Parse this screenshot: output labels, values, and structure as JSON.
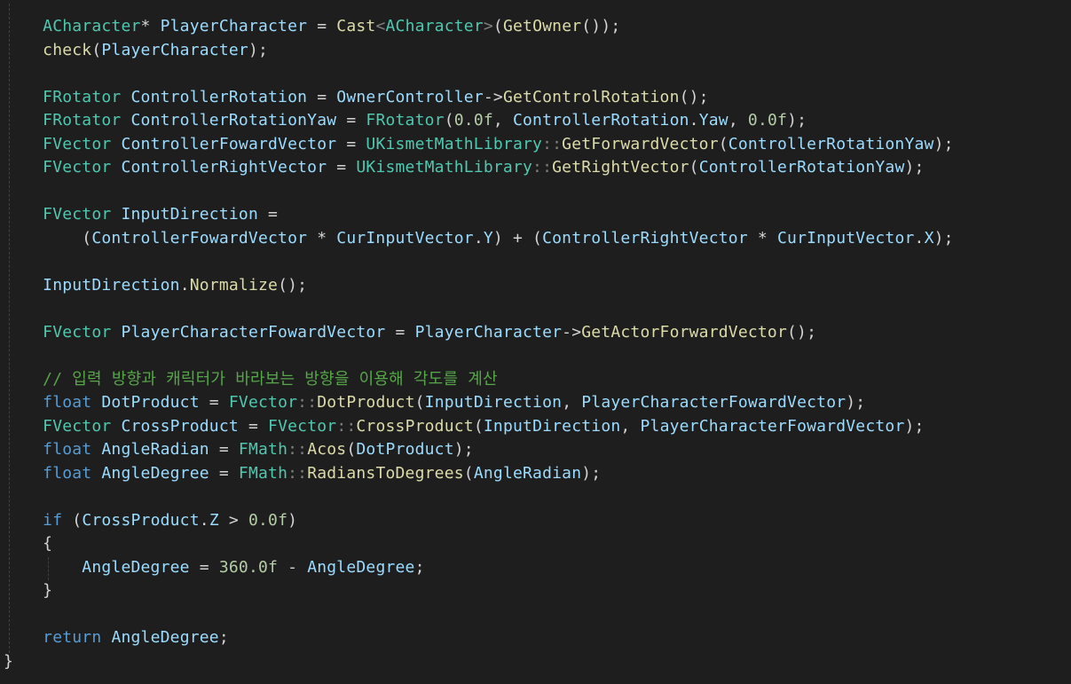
{
  "editor": {
    "theme_colors": {
      "background": "#1e1e1e",
      "type": "#4ec9b0",
      "variable": "#9cdcfe",
      "function": "#dcdcaa",
      "keyword": "#569cd6",
      "control": "#c586c0",
      "number": "#b5cea8",
      "comment": "#57a64a",
      "plain": "#d4d4d4"
    },
    "lines": [
      {
        "indent": "    ",
        "tokens": [
          {
            "t": "ACharacter",
            "c": "type"
          },
          {
            "t": "* ",
            "c": "op"
          },
          {
            "t": "PlayerCharacter",
            "c": "var"
          },
          {
            "t": " = ",
            "c": "op"
          },
          {
            "t": "Cast",
            "c": "fn"
          },
          {
            "t": "<",
            "c": "sep"
          },
          {
            "t": "ACharacter",
            "c": "type"
          },
          {
            "t": ">",
            "c": "sep"
          },
          {
            "t": "(",
            "c": "punc"
          },
          {
            "t": "GetOwner",
            "c": "fn"
          },
          {
            "t": "());",
            "c": "punc"
          }
        ]
      },
      {
        "indent": "    ",
        "tokens": [
          {
            "t": "check",
            "c": "fn"
          },
          {
            "t": "(",
            "c": "punc"
          },
          {
            "t": "PlayerCharacter",
            "c": "var"
          },
          {
            "t": ");",
            "c": "punc"
          }
        ]
      },
      {
        "indent": "",
        "tokens": []
      },
      {
        "indent": "    ",
        "tokens": [
          {
            "t": "FRotator",
            "c": "type"
          },
          {
            "t": " ",
            "c": "op"
          },
          {
            "t": "ControllerRotation",
            "c": "var"
          },
          {
            "t": " = ",
            "c": "op"
          },
          {
            "t": "OwnerController",
            "c": "var"
          },
          {
            "t": "->",
            "c": "op"
          },
          {
            "t": "GetControlRotation",
            "c": "fn"
          },
          {
            "t": "();",
            "c": "punc"
          }
        ]
      },
      {
        "indent": "    ",
        "tokens": [
          {
            "t": "FRotator",
            "c": "type"
          },
          {
            "t": " ",
            "c": "op"
          },
          {
            "t": "ControllerRotationYaw",
            "c": "var"
          },
          {
            "t": " = ",
            "c": "op"
          },
          {
            "t": "FRotator",
            "c": "type"
          },
          {
            "t": "(",
            "c": "punc"
          },
          {
            "t": "0.0f",
            "c": "num"
          },
          {
            "t": ", ",
            "c": "punc"
          },
          {
            "t": "ControllerRotation",
            "c": "var"
          },
          {
            "t": ".",
            "c": "punc"
          },
          {
            "t": "Yaw",
            "c": "var"
          },
          {
            "t": ", ",
            "c": "punc"
          },
          {
            "t": "0.0f",
            "c": "num"
          },
          {
            "t": ");",
            "c": "punc"
          }
        ]
      },
      {
        "indent": "    ",
        "tokens": [
          {
            "t": "FVector",
            "c": "type"
          },
          {
            "t": " ",
            "c": "op"
          },
          {
            "t": "ControllerFowardVector",
            "c": "var"
          },
          {
            "t": " = ",
            "c": "op"
          },
          {
            "t": "UKismetMathLibrary",
            "c": "type"
          },
          {
            "t": "::",
            "c": "sep"
          },
          {
            "t": "GetForwardVector",
            "c": "fn"
          },
          {
            "t": "(",
            "c": "punc"
          },
          {
            "t": "ControllerRotationYaw",
            "c": "var"
          },
          {
            "t": ");",
            "c": "punc"
          }
        ]
      },
      {
        "indent": "    ",
        "tokens": [
          {
            "t": "FVector",
            "c": "type"
          },
          {
            "t": " ",
            "c": "op"
          },
          {
            "t": "ControllerRightVector",
            "c": "var"
          },
          {
            "t": " = ",
            "c": "op"
          },
          {
            "t": "UKismetMathLibrary",
            "c": "type"
          },
          {
            "t": "::",
            "c": "sep"
          },
          {
            "t": "GetRightVector",
            "c": "fn"
          },
          {
            "t": "(",
            "c": "punc"
          },
          {
            "t": "ControllerRotationYaw",
            "c": "var"
          },
          {
            "t": ");",
            "c": "punc"
          }
        ]
      },
      {
        "indent": "",
        "tokens": []
      },
      {
        "indent": "    ",
        "tokens": [
          {
            "t": "FVector",
            "c": "type"
          },
          {
            "t": " ",
            "c": "op"
          },
          {
            "t": "InputDirection",
            "c": "var"
          },
          {
            "t": " =",
            "c": "op"
          }
        ]
      },
      {
        "indent": "        ",
        "tokens": [
          {
            "t": "(",
            "c": "punc"
          },
          {
            "t": "ControllerFowardVector",
            "c": "var"
          },
          {
            "t": " * ",
            "c": "op"
          },
          {
            "t": "CurInputVector",
            "c": "var"
          },
          {
            "t": ".",
            "c": "punc"
          },
          {
            "t": "Y",
            "c": "var"
          },
          {
            "t": ") + (",
            "c": "punc"
          },
          {
            "t": "ControllerRightVector",
            "c": "var"
          },
          {
            "t": " * ",
            "c": "op"
          },
          {
            "t": "CurInputVector",
            "c": "var"
          },
          {
            "t": ".",
            "c": "punc"
          },
          {
            "t": "X",
            "c": "var"
          },
          {
            "t": ");",
            "c": "punc"
          }
        ]
      },
      {
        "indent": "",
        "tokens": []
      },
      {
        "indent": "    ",
        "tokens": [
          {
            "t": "InputDirection",
            "c": "var"
          },
          {
            "t": ".",
            "c": "punc"
          },
          {
            "t": "Normalize",
            "c": "fn"
          },
          {
            "t": "();",
            "c": "punc"
          }
        ]
      },
      {
        "indent": "",
        "tokens": []
      },
      {
        "indent": "    ",
        "tokens": [
          {
            "t": "FVector",
            "c": "type"
          },
          {
            "t": " ",
            "c": "op"
          },
          {
            "t": "PlayerCharacterFowardVector",
            "c": "var"
          },
          {
            "t": " = ",
            "c": "op"
          },
          {
            "t": "PlayerCharacter",
            "c": "var"
          },
          {
            "t": "->",
            "c": "op"
          },
          {
            "t": "GetActorForwardVector",
            "c": "fn"
          },
          {
            "t": "();",
            "c": "punc"
          }
        ]
      },
      {
        "indent": "",
        "tokens": []
      },
      {
        "indent": "    ",
        "tokens": [
          {
            "t": "// 입력 방향과 캐릭터가 바라보는 방향을 이용해 각도를 계산",
            "c": "cmt"
          }
        ]
      },
      {
        "indent": "    ",
        "tokens": [
          {
            "t": "float",
            "c": "kw"
          },
          {
            "t": " ",
            "c": "op"
          },
          {
            "t": "DotProduct",
            "c": "var"
          },
          {
            "t": " = ",
            "c": "op"
          },
          {
            "t": "FVector",
            "c": "type"
          },
          {
            "t": "::",
            "c": "sep"
          },
          {
            "t": "DotProduct",
            "c": "fn"
          },
          {
            "t": "(",
            "c": "punc"
          },
          {
            "t": "InputDirection",
            "c": "var"
          },
          {
            "t": ", ",
            "c": "punc"
          },
          {
            "t": "PlayerCharacterFowardVector",
            "c": "var"
          },
          {
            "t": ");",
            "c": "punc"
          }
        ]
      },
      {
        "indent": "    ",
        "tokens": [
          {
            "t": "FVector",
            "c": "type"
          },
          {
            "t": " ",
            "c": "op"
          },
          {
            "t": "CrossProduct",
            "c": "var"
          },
          {
            "t": " = ",
            "c": "op"
          },
          {
            "t": "FVector",
            "c": "type"
          },
          {
            "t": "::",
            "c": "sep"
          },
          {
            "t": "CrossProduct",
            "c": "fn"
          },
          {
            "t": "(",
            "c": "punc"
          },
          {
            "t": "InputDirection",
            "c": "var"
          },
          {
            "t": ", ",
            "c": "punc"
          },
          {
            "t": "PlayerCharacterFowardVector",
            "c": "var"
          },
          {
            "t": ");",
            "c": "punc"
          }
        ]
      },
      {
        "indent": "    ",
        "tokens": [
          {
            "t": "float",
            "c": "kw"
          },
          {
            "t": " ",
            "c": "op"
          },
          {
            "t": "AngleRadian",
            "c": "var"
          },
          {
            "t": " = ",
            "c": "op"
          },
          {
            "t": "FMath",
            "c": "type"
          },
          {
            "t": "::",
            "c": "sep"
          },
          {
            "t": "Acos",
            "c": "fn"
          },
          {
            "t": "(",
            "c": "punc"
          },
          {
            "t": "DotProduct",
            "c": "var"
          },
          {
            "t": ");",
            "c": "punc"
          }
        ]
      },
      {
        "indent": "    ",
        "tokens": [
          {
            "t": "float",
            "c": "kw"
          },
          {
            "t": " ",
            "c": "op"
          },
          {
            "t": "AngleDegree",
            "c": "var"
          },
          {
            "t": " = ",
            "c": "op"
          },
          {
            "t": "FMath",
            "c": "type"
          },
          {
            "t": "::",
            "c": "sep"
          },
          {
            "t": "RadiansToDegrees",
            "c": "fn"
          },
          {
            "t": "(",
            "c": "punc"
          },
          {
            "t": "AngleRadian",
            "c": "var"
          },
          {
            "t": ");",
            "c": "punc"
          }
        ]
      },
      {
        "indent": "",
        "tokens": []
      },
      {
        "indent": "    ",
        "tokens": [
          {
            "t": "if",
            "c": "kw"
          },
          {
            "t": " (",
            "c": "punc"
          },
          {
            "t": "CrossProduct",
            "c": "var"
          },
          {
            "t": ".",
            "c": "punc"
          },
          {
            "t": "Z",
            "c": "var"
          },
          {
            "t": " > ",
            "c": "op"
          },
          {
            "t": "0.0f",
            "c": "num"
          },
          {
            "t": ")",
            "c": "punc"
          }
        ]
      },
      {
        "indent": "    ",
        "tokens": [
          {
            "t": "{",
            "c": "punc"
          }
        ]
      },
      {
        "indent": "        ",
        "tokens": [
          {
            "t": "AngleDegree",
            "c": "var"
          },
          {
            "t": " = ",
            "c": "op"
          },
          {
            "t": "360.0f",
            "c": "num"
          },
          {
            "t": " - ",
            "c": "op"
          },
          {
            "t": "AngleDegree",
            "c": "var"
          },
          {
            "t": ";",
            "c": "punc"
          }
        ]
      },
      {
        "indent": "    ",
        "tokens": [
          {
            "t": "}",
            "c": "punc"
          }
        ]
      },
      {
        "indent": "",
        "tokens": []
      },
      {
        "indent": "    ",
        "tokens": [
          {
            "t": "return",
            "c": "kw"
          },
          {
            "t": " ",
            "c": "op"
          },
          {
            "t": "AngleDegree",
            "c": "var"
          },
          {
            "t": ";",
            "c": "punc"
          }
        ]
      },
      {
        "indent": "",
        "tokens": [
          {
            "t": "}",
            "c": "punc"
          }
        ]
      }
    ]
  }
}
